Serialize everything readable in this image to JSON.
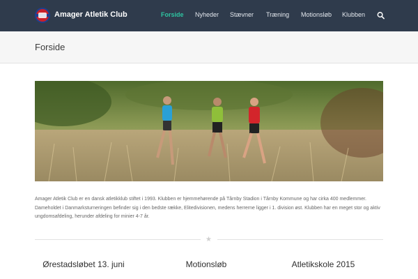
{
  "header": {
    "brand": "Amager Atletik Club",
    "nav": [
      {
        "label": "Forside"
      },
      {
        "label": "Nyheder"
      },
      {
        "label": "Stævner"
      },
      {
        "label": "Træning"
      },
      {
        "label": "Motionsløb"
      },
      {
        "label": "Klubben"
      }
    ]
  },
  "page": {
    "title": "Forside",
    "intro": "Amager Atletik Club er en dansk atletikklub stiftet i 1993. Klubben er hjemmehørende på Tårnby Stadion i Tårnby Kommune og har cirka 400 medlemmer. Dameholdet i Danmarksturneringen befinder sig i den bedste række, Elitedivisionen, medens herrerne ligger i 1. division øst. Klubben har en meget stor og aktiv ungdomsafdeling, herunder afdeling for minier 4-7 år."
  },
  "columns": [
    {
      "title": "Ørestadsløbet 13. juni"
    },
    {
      "title": "Motionsløb"
    },
    {
      "title": "Atletikskole 2015"
    }
  ],
  "colors": {
    "header_bg": "#2f3b4c",
    "accent": "#2ec4a1"
  }
}
